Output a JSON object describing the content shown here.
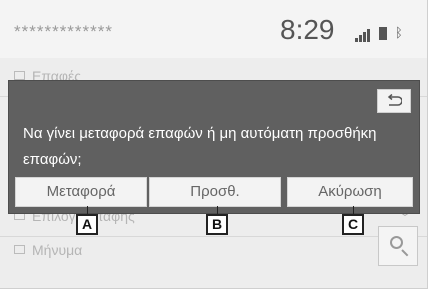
{
  "status_bar": {
    "masked_name": "*************",
    "time": "8:29",
    "signal_icon": "signal-bars-icon",
    "battery_icon": "battery-icon",
    "bluetooth_icon": "bluetooth-icon"
  },
  "background": {
    "rows": [
      {
        "label": "Επαφές"
      },
      {
        "label": "Επιλογή επαφής"
      },
      {
        "label": "Μήνυμα"
      }
    ]
  },
  "dialog": {
    "message": "Να γίνει μεταφορά επαφών ή μη αυτόματη προσθήκη επαφών;",
    "back_icon": "return-arrow-icon",
    "buttons": {
      "transfer": "Μεταφορά",
      "add": "Προσθ.",
      "cancel": "Ακύρωση"
    }
  },
  "callouts": {
    "a": "A",
    "b": "B",
    "c": "C"
  },
  "colors": {
    "dialog_bg": "#606060",
    "button_bg": "#f3f3f3",
    "screen_bg": "#ededed"
  }
}
